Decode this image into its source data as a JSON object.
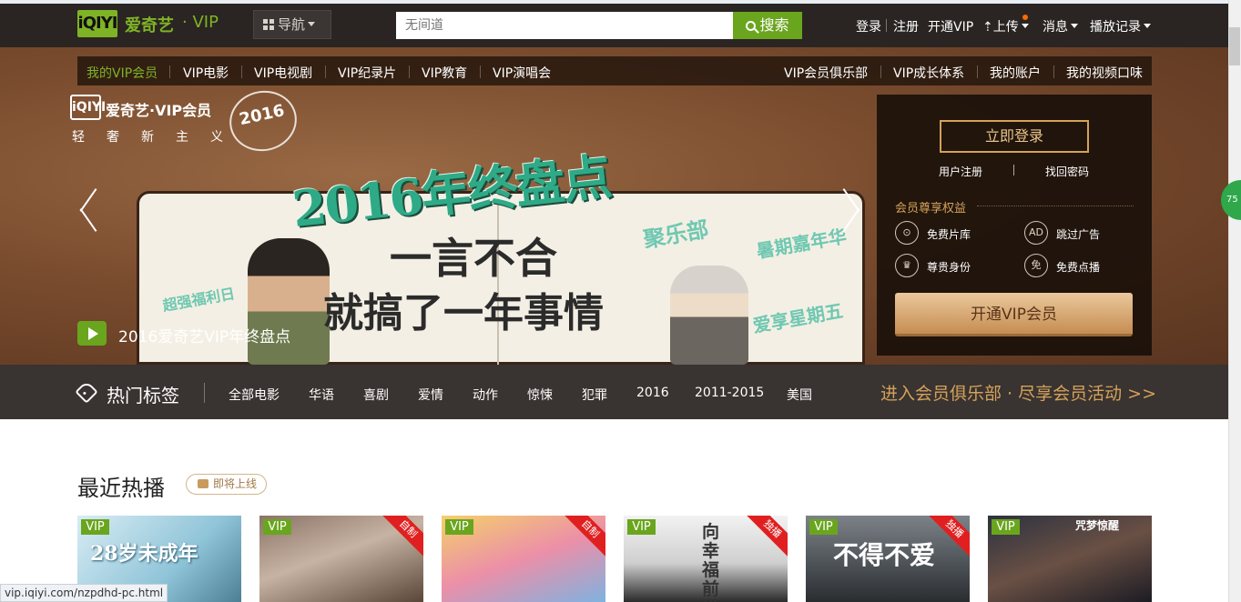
{
  "header": {
    "logo_mark": "iQIYI",
    "logo_text": "爱奇艺",
    "logo_suffix": "· VIP",
    "nav_label": "导航",
    "search_placeholder": "无间道",
    "search_button": "搜索",
    "login": "登录",
    "register": "注册",
    "open_vip": "开通VIP",
    "upload": "上传",
    "messages": "消息",
    "history": "播放记录"
  },
  "subnav": {
    "left": [
      "我的VIP会员",
      "VIP电影",
      "VIP电视剧",
      "VIP纪录片",
      "VIP教育",
      "VIP演唱会"
    ],
    "right": [
      "VIP会员俱乐部",
      "VIP成长体系",
      "我的账户",
      "我的视频口味"
    ]
  },
  "banner": {
    "brand_mark": "iQIYI",
    "brand": "爱奇艺·VIP会员",
    "slogan": "轻奢新主义",
    "seal_text": "2016",
    "headline": "2016年终盘点",
    "line1": "一言不合",
    "line2": "就搞了一年事情",
    "stamps": [
      "聚乐部",
      "暑期嘉年华",
      "超强福利日",
      "爱享星期五"
    ],
    "caption": "2016爱奇艺VIP年终盘点"
  },
  "login_panel": {
    "login_button": "立即登录",
    "register_link": "用户注册",
    "recover_link": "找回密码",
    "rights_title": "会员尊享权益",
    "benefits": [
      "免费片库",
      "跳过广告",
      "尊贵身份",
      "免费点播"
    ],
    "benefit_icons": [
      "film-reel-icon",
      "ad-skip-icon",
      "crown-icon",
      "free-icon"
    ],
    "icon_glyphs": [
      "⊙",
      "AD",
      "♛",
      "免"
    ],
    "open_vip_button": "开通VIP会员"
  },
  "tags": {
    "title": "热门标签",
    "items": [
      "全部电影",
      "华语",
      "喜剧",
      "爱情",
      "动作",
      "惊悚",
      "犯罪",
      "2016",
      "2011-2015",
      "美国"
    ],
    "club_link": "进入会员俱乐部 · 尽享会员活动 >>"
  },
  "recent": {
    "title": "最近热播",
    "upcoming_label": "即将上线",
    "posters": [
      {
        "badge": "VIP",
        "corner": "",
        "title": "28岁未成年"
      },
      {
        "badge": "VIP",
        "corner": "自制",
        "title": ""
      },
      {
        "badge": "VIP",
        "corner": "自制",
        "title": ""
      },
      {
        "badge": "VIP",
        "corner": "独播",
        "title": "向幸福前进"
      },
      {
        "badge": "VIP",
        "corner": "独播",
        "title": "不得不爱"
      },
      {
        "badge": "VIP",
        "corner": "",
        "title": "咒梦惊醒"
      }
    ]
  },
  "status_bar": {
    "url": "vip.iqiyi.com/nzpdhd-pc.html"
  },
  "side_badge": "75",
  "colors": {
    "brand_green": "#6aa51e",
    "gold": "#d4a25a",
    "topbar": "#2a2523"
  }
}
